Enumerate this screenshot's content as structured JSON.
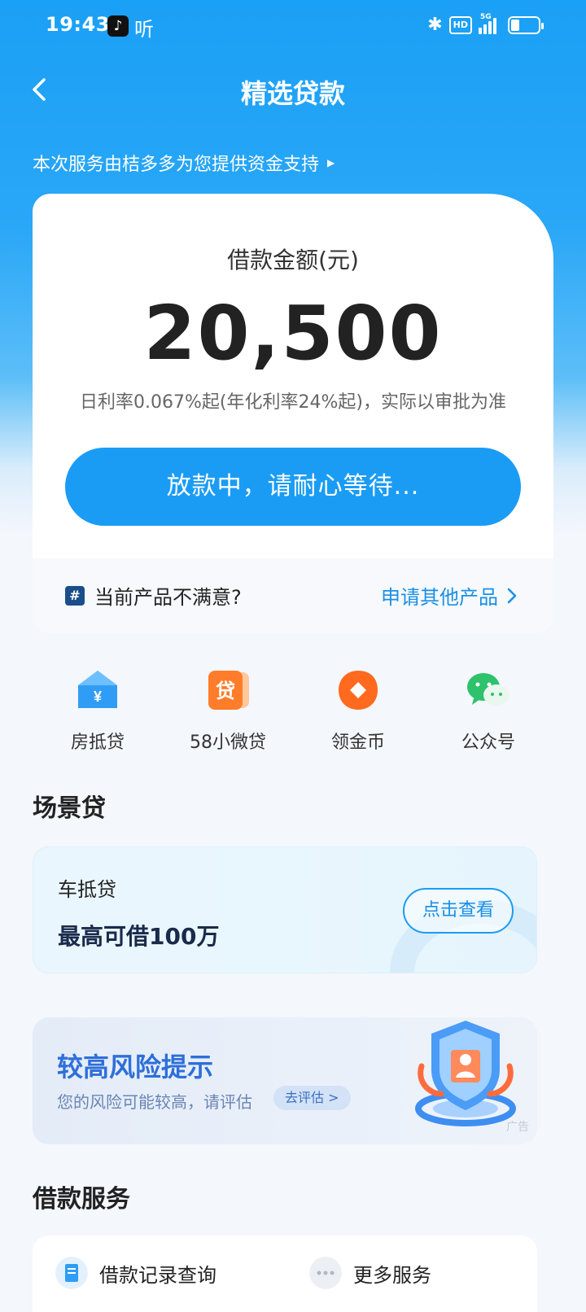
{
  "status_bar": {
    "time": "19:43",
    "tiktok_glyph": "♪",
    "listen_glyph": "听",
    "bluetooth_glyph": "✱",
    "hd_label": "HD",
    "network_label": "5G",
    "battery_level": 0.3
  },
  "nav": {
    "title": "精选贷款",
    "back_icon": "chevron-left-icon"
  },
  "provider_notice": "本次服务由桔多多为您提供资金支持",
  "loan_card": {
    "amount_label": "借款金额(元)",
    "amount": "20,500",
    "rate_text": "日利率0.067%起(年化利率24%起)，实际以审批为准",
    "status_button": "放款中，请耐心等待...",
    "unsatisfied_text": "当前产品不满意?",
    "other_products_link": "申请其他产品"
  },
  "quick_entries": [
    {
      "label": "房抵贷",
      "icon": "house-loan-icon",
      "glyph": "¥"
    },
    {
      "label": "58小微贷",
      "icon": "micro-loan-icon",
      "glyph": "贷"
    },
    {
      "label": "领金币",
      "icon": "gold-coin-icon",
      "glyph": ""
    },
    {
      "label": "公众号",
      "icon": "wechat-icon",
      "glyph": ""
    }
  ],
  "scene_section": {
    "title": "场景贷",
    "card_name": "车抵贷",
    "card_desc": "最高可借100万",
    "card_button": "点击查看"
  },
  "risk_banner": {
    "title": "较高风险提示",
    "desc": "您的风险可能较高，请评估",
    "button": "去评估 >",
    "ad_label": "广告"
  },
  "service_section": {
    "title": "借款服务",
    "items": [
      "借款记录查询",
      "更多服务"
    ]
  },
  "colors": {
    "brand_blue": "#1a9cf5",
    "link_blue": "#1a8fe6",
    "risk_blue": "#2e6fd9"
  }
}
